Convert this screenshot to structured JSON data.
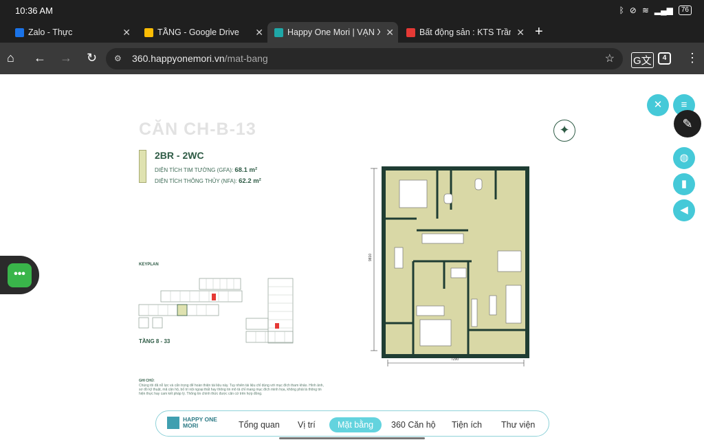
{
  "status_bar": {
    "time": "10:36 AM",
    "battery": "76"
  },
  "tabs": [
    {
      "title": "Zalo - Thực",
      "favicon_color": "#1a73e8"
    },
    {
      "title": "TẦNG - Google Drive",
      "favicon_color": "#fbbc04"
    },
    {
      "title": "Happy One Mori | VẠN XUÂN",
      "favicon_color": "#1fa8a8"
    },
    {
      "title": "Bất động sản : KTS Trần Ngọc",
      "favicon_color": "#e53935"
    }
  ],
  "address_bar": {
    "host": "360.happyonemori.vn",
    "path": "/mat-bang"
  },
  "toolbar": {
    "tab_count": "4"
  },
  "floorplan": {
    "apartment_title": "CĂN CH-B-13",
    "unit_type": "2BR - 2WC",
    "gfa_label": "DIỆN TÍCH TIM TƯỜNG (GFA):",
    "gfa_value": "68.1 m²",
    "nfa_label": "DIỆN TÍCH THÔNG THỦY (NFA):",
    "nfa_value": "62.2 m²",
    "keyplan_label": "KEYPLAN",
    "floor_range": "TẦNG 8 - 33",
    "dimension_width": "7290",
    "dimension_height": "9810",
    "notes_title": "GHI CHÚ:",
    "notes_text": "Chúng tôi đã nỗ lực và cẩn trọng để hoàn thiện tài liệu này. Tuy nhiên tài liệu chỉ dùng với mục đích tham khảo. Hình ảnh, sơ đồ kỹ thuật, mã căn hộ, bố trí nội ngoại thất hay thông tin mô tả chỉ mang mục đích minh họa, không phải là thông tin hiện thực hay cam kết pháp lý. Thông tin chính thức được căn cứ trên hợp đồng.",
    "colors": {
      "accent": "#2e5b45",
      "room_fill": "#d9d8a6",
      "wall": "#1f3d33",
      "highlight": "#e53935"
    }
  },
  "bottom_nav": {
    "logo_line1": "HAPPY ONE",
    "logo_line2": "MORI",
    "items": [
      "Tổng quan",
      "Vị trí",
      "Mặt bằng",
      "360 Căn hộ",
      "Tiện ích",
      "Thư viện"
    ],
    "active": "Mặt bằng"
  },
  "side_buttons": [
    "close-icon",
    "menu-icon",
    "globe-icon",
    "book-icon",
    "speaker-icon"
  ],
  "icons": {
    "home": "⌂",
    "back": "←",
    "forward": "→",
    "reload": "↻",
    "star": "☆",
    "more": "⋮",
    "close": "✕",
    "menu": "≡",
    "globe": "◍",
    "book": "▮",
    "speaker": "◀",
    "pen": "✎",
    "chat": "•••",
    "compass": "✦"
  }
}
